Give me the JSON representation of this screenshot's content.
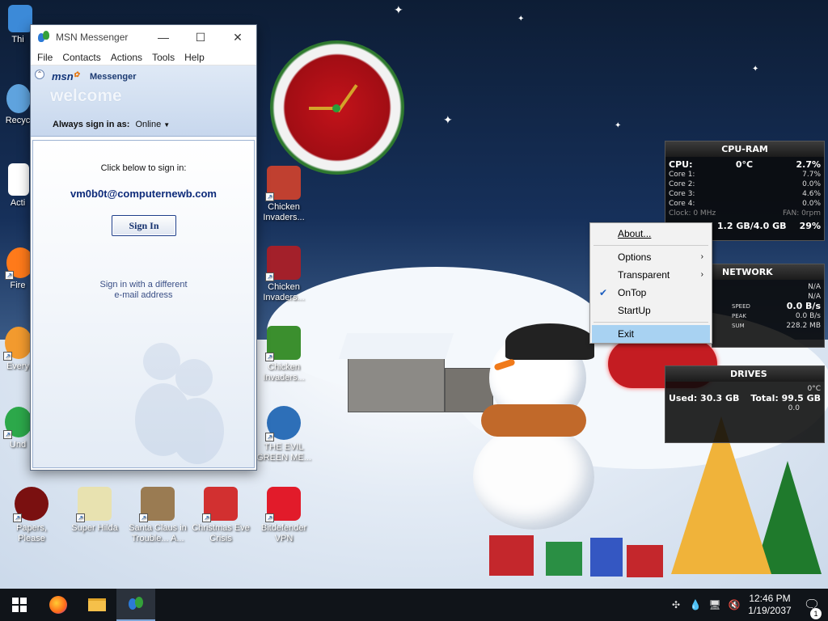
{
  "desktop_icons": [
    {
      "name": "This PC",
      "label": "Thi",
      "color": "#3c8ad8"
    },
    {
      "name": "Recycle Bin",
      "label": "Recyc",
      "color": "#5fa3de"
    },
    {
      "name": "Activation",
      "label": "Acti",
      "color": "#ffffff"
    },
    {
      "name": "Firefox",
      "label": "Fire",
      "color": "#ff7a1a"
    },
    {
      "name": "Everything",
      "label": "Every",
      "color": "#f29a2e"
    },
    {
      "name": "Undertale",
      "label": "Und",
      "color": "#2ca84a"
    },
    {
      "name": "Chicken Invaders 1",
      "label": "Chicken Invaders...",
      "color": "#c04030"
    },
    {
      "name": "Chicken Invaders 2",
      "label": "Chicken Invaders...",
      "color": "#a3202a"
    },
    {
      "name": "Chicken Invaders 3",
      "label": "Chicken Invaders...",
      "color": "#3b8f2e"
    },
    {
      "name": "The Evil Green",
      "label": "THE EVIL GREEN ME...",
      "color": "#2d6fb8"
    },
    {
      "name": "Papers, Please",
      "label": "Papers, Please",
      "color": "#7a1010"
    },
    {
      "name": "Super Hilda",
      "label": "Super Hilda",
      "color": "#e8e2b0"
    },
    {
      "name": "Santa Claus in Trouble",
      "label": "Santa Claus in Trouble... A...",
      "color": "#9a7b52"
    },
    {
      "name": "Christmas Eve Crisis",
      "label": "Christmas Eve Crisis",
      "color": "#d23030"
    },
    {
      "name": "Bitdefender VPN",
      "label": "Bitdefender VPN",
      "color": "#e21b2a"
    }
  ],
  "msn_window": {
    "title": "MSN Messenger",
    "menu": [
      "File",
      "Contacts",
      "Actions",
      "Tools",
      "Help"
    ],
    "logo": "msn",
    "logo_word": "Messenger",
    "welcome": "welcome",
    "always_sign_in_label": "Always sign in as:",
    "status": "Online",
    "click_below": "Click below to sign in:",
    "email": "vm0b0t@computernewb.com",
    "sign_in_button": "Sign In",
    "different_line1": "Sign in with a different",
    "different_line2": "e-mail address"
  },
  "context_menu": {
    "items": [
      {
        "label": "About...",
        "type": "item"
      },
      {
        "type": "sep"
      },
      {
        "label": "Options",
        "submenu": true
      },
      {
        "label": "Transparent",
        "submenu": true
      },
      {
        "label": "OnTop",
        "checked": true
      },
      {
        "label": "StartUp"
      },
      {
        "type": "sep"
      },
      {
        "label": "Exit",
        "highlighted": true
      }
    ]
  },
  "cpu_gadget": {
    "title": "CPU-RAM",
    "cpu_label": "CPU:",
    "cpu_temp": "0°C",
    "cpu_percent": "2.7%",
    "cores": [
      {
        "label": "Core 1:",
        "value": "7.7%"
      },
      {
        "label": "Core 2:",
        "value": "0.0%"
      },
      {
        "label": "Core 3:",
        "value": "4.6%"
      },
      {
        "label": "Core 4:",
        "value": "0.0%"
      }
    ],
    "clock": "Clock: 0 MHz",
    "fan": "FAN: 0rpm",
    "ram": "1.2 GB/4.0 GB",
    "ram_percent": "29%"
  },
  "network_gadget": {
    "title": "NETWORK",
    "na1": "N/A",
    "na2": "N/A",
    "speed_label": "SPEED",
    "speed": "0.0 B/s",
    "peak_label": "PEAK",
    "peak": "0.0 B/s",
    "sum_label": "SUM",
    "sum": "228.2 MB"
  },
  "drives_gadget": {
    "title": "DRIVES",
    "temp": "0°C",
    "used": "Used: 30.3 GB",
    "total": "Total: 99.5 GB",
    "rate": "0.0"
  },
  "taskbar": {
    "time": "12:46 PM",
    "date": "1/19/2037",
    "notifications": "1"
  },
  "colors": {
    "msn_blue": "#13367a",
    "menu_highlight": "#a8d2f2",
    "taskbar": "#101419"
  }
}
